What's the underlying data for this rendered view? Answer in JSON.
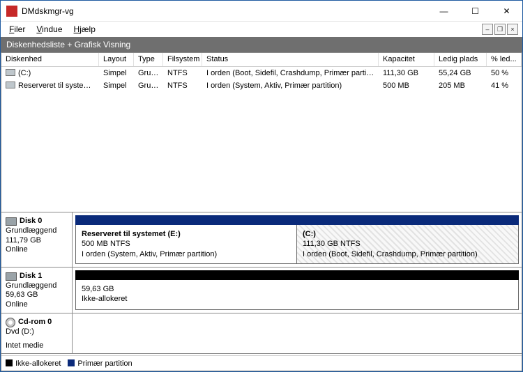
{
  "window": {
    "title": "DMdskmgr-vg"
  },
  "menu": {
    "file": "Filer",
    "window": "Vindue",
    "help": "Hjælp"
  },
  "band": {
    "text": "Diskenhedsliste + Grafisk Visning"
  },
  "columns": {
    "disk": "Diskenhed",
    "layout": "Layout",
    "type": "Type",
    "fs": "Filsystem",
    "status": "Status",
    "cap": "Kapacitet",
    "free": "Ledig plads",
    "pct": "% led..."
  },
  "volumes": [
    {
      "name": "(C:)",
      "layout": "Simpel",
      "type": "Grun...",
      "fs": "NTFS",
      "status": "I orden (Boot, Sidefil, Crashdump, Primær partition)",
      "cap": "111,30 GB",
      "free": "55,24 GB",
      "pct": "50 %"
    },
    {
      "name": "Reserveret til systemet...",
      "layout": "Simpel",
      "type": "Grun...",
      "fs": "NTFS",
      "status": "I orden (System, Aktiv, Primær partition)",
      "cap": "500 MB",
      "free": "205 MB",
      "pct": "41 %"
    }
  ],
  "disks": {
    "d0": {
      "name": "Disk 0",
      "kind": "Grundlæggend",
      "size": "111,79 GB",
      "state": "Online",
      "p0": {
        "title": "Reserveret til systemet  (E:)",
        "sub": "500 MB NTFS",
        "status": "I orden (System, Aktiv, Primær partition)"
      },
      "p1": {
        "title": " (C:)",
        "sub": "111,30 GB NTFS",
        "status": "I orden (Boot, Sidefil, Crashdump, Primær partition)"
      }
    },
    "d1": {
      "name": "Disk 1",
      "kind": "Grundlæggend",
      "size": "59,63 GB",
      "state": "Online",
      "p0": {
        "title": "",
        "sub": "59,63 GB",
        "status": "Ikke-allokeret"
      }
    },
    "cd": {
      "name": "Cd-rom 0",
      "kind": "Dvd (D:)",
      "size": "",
      "state": "Intet medie"
    }
  },
  "legend": {
    "unalloc": "Ikke-allokeret",
    "primary": "Primær partition"
  }
}
